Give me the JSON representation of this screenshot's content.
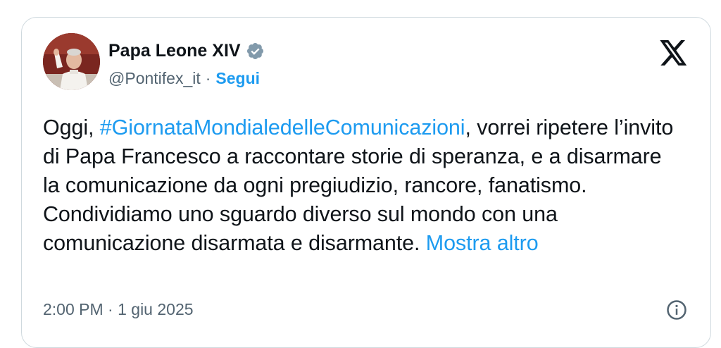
{
  "author": {
    "display_name": "Papa Leone XIV",
    "handle": "@Pontifex_it",
    "separator": "·",
    "follow_label": "Segui",
    "verified_icon": "verified-badge-icon",
    "avatar": "avatar-photo"
  },
  "brand": {
    "logo_icon": "x-logo-icon",
    "accent_color": "#1d9bf0",
    "verified_color": "#829aab"
  },
  "tweet": {
    "text_before": "Oggi, ",
    "hashtag": "#GiornataMondialedelleComunicazioni",
    "text_after": ", vorrei ripetere l’invito di Papa Francesco a raccontare storie di speranza, e a disarmare la comunicazione da ogni pregiudizio, rancore, fanatismo. Condividiamo uno sguardo diverso sul mondo con una comunicazione disarmata e disarmante. ",
    "show_more_label": "Mostra altro"
  },
  "meta": {
    "timestamp": "2:00 PM · 1 giu 2025",
    "info_icon": "info-icon"
  }
}
